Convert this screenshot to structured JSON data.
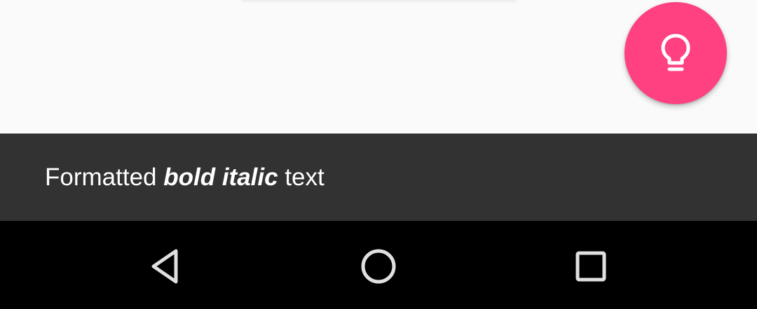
{
  "colors": {
    "content_background": "#fafafa",
    "fab_accent": "#ff4081",
    "snackbar_background": "#323232",
    "navbar_background": "#000000",
    "nav_icon": "#e0e0e0",
    "fab_icon": "#ffffff"
  },
  "fab": {
    "icon": "lightbulb-icon"
  },
  "snackbar": {
    "text_before": "Formatted ",
    "text_bold_italic": "bold italic",
    "text_after": " text"
  },
  "navbar": {
    "back_icon": "back-triangle-icon",
    "home_icon": "home-circle-icon",
    "recents_icon": "recents-square-icon"
  }
}
